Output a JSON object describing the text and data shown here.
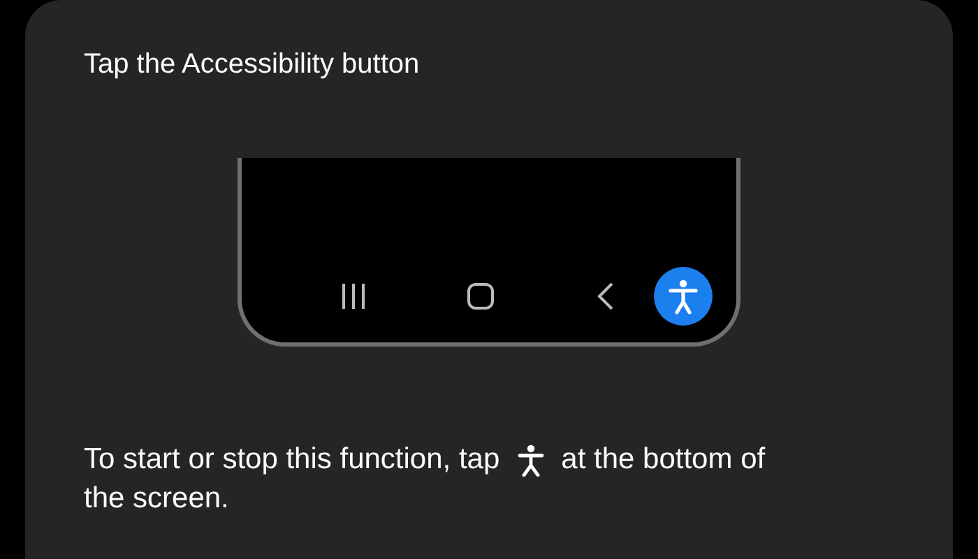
{
  "title": "Tap the Accessibility button",
  "instruction": {
    "before_icon": "To start or stop this function, tap",
    "after_icon": "at the bottom of",
    "second_line": "the screen."
  }
}
